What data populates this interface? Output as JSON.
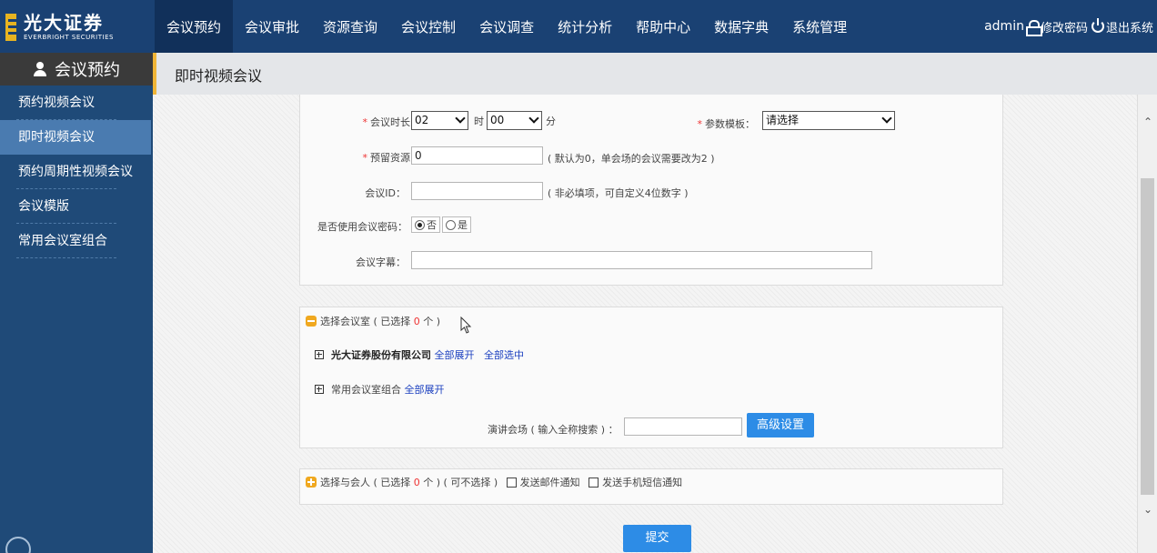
{
  "header": {
    "logo_cn": "光大证券",
    "logo_en": "EVERBRIGHT SECURITIES",
    "nav": [
      "会议预约",
      "会议审批",
      "资源查询",
      "会议控制",
      "会议调查",
      "统计分析",
      "帮助中心",
      "数据字典",
      "系统管理"
    ],
    "active_nav": "会议预约",
    "username": "admin",
    "change_password": "修改密码",
    "logout": "退出系统",
    "bg_color": "#1a4173"
  },
  "sidebar": {
    "title": "会议预约",
    "items": [
      "预约视频会议",
      "即时视频会议",
      "预约周期性视频会议",
      "会议模版",
      "常用会议室组合"
    ],
    "active_item": "即时视频会议"
  },
  "page": {
    "breadcrumb": "即时视频会议"
  },
  "form": {
    "duration_label": "会议时长：",
    "duration_hours": "02",
    "hours_unit": "时",
    "duration_minutes": "00",
    "minutes_unit": "分",
    "template_label": "参数模板：",
    "template_value": "请选择",
    "reserve_label": "预留资源：",
    "reserve_value": "0",
    "reserve_hint": "( 默认为0，单会场的会议需要改为2 )",
    "meeting_id_label": "会议ID：",
    "meeting_id_value": "",
    "meeting_id_hint": "( 非必填项，可自定义4位数字 )",
    "password_label": "是否使用会议密码：",
    "password_no": "否",
    "password_yes": "是",
    "subtitle_label": "会议字幕：",
    "subtitle_value": ""
  },
  "rooms": {
    "header_prefix": "选择会议室 ( 已选择 ",
    "selected_count": "0",
    "header_suffix": " 个 )",
    "org_name": "光大证券股份有限公司",
    "expand_all": "全部展开",
    "select_all": "全部选中",
    "common_group": "常用会议室组合",
    "common_expand_all": "全部展开",
    "speaker_label": "演讲会场 ( 输入全称搜索 ) ：",
    "speaker_value": "",
    "advanced_button": "高级设置"
  },
  "participants": {
    "header_prefix": "选择与会人 ( 已选择 ",
    "selected_count": "0",
    "header_suffix": " 个 ) ( 可不选择 )",
    "email_notify": "发送邮件通知",
    "sms_notify": "发送手机短信通知"
  },
  "submit_button": "提交"
}
